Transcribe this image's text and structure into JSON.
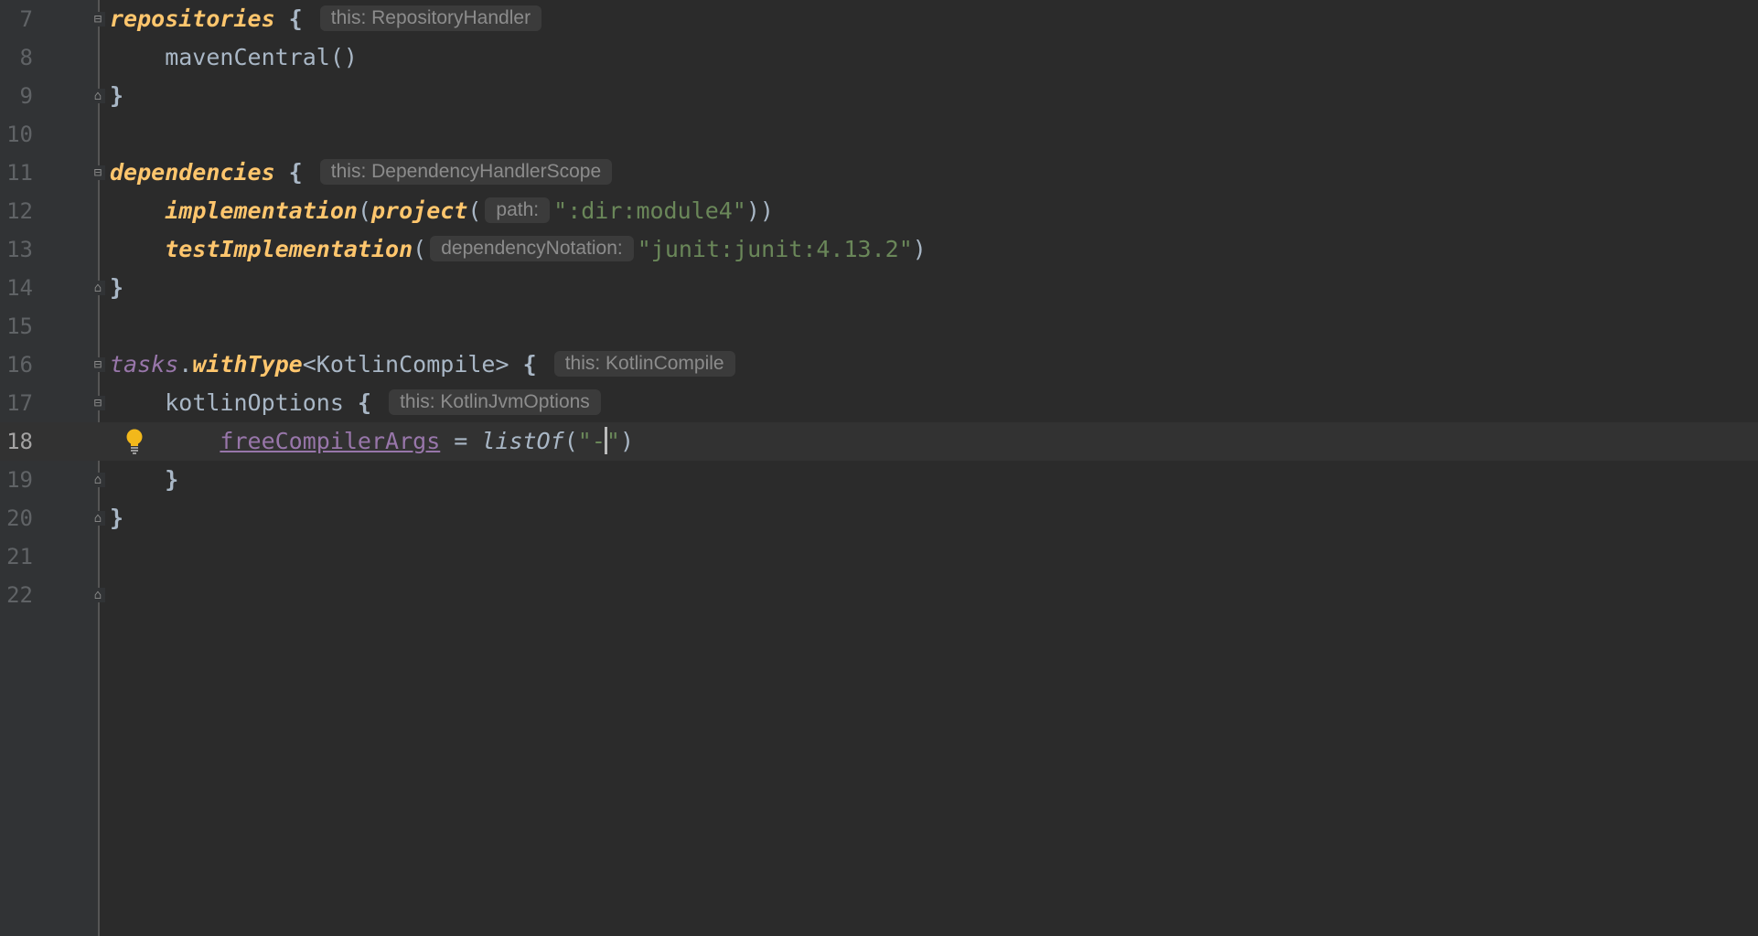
{
  "editor": {
    "lines": [
      {
        "num": "7"
      },
      {
        "num": "8"
      },
      {
        "num": "9"
      },
      {
        "num": "10"
      },
      {
        "num": "11"
      },
      {
        "num": "12"
      },
      {
        "num": "13"
      },
      {
        "num": "14"
      },
      {
        "num": "15"
      },
      {
        "num": "16"
      },
      {
        "num": "17"
      },
      {
        "num": "18"
      },
      {
        "num": "19"
      },
      {
        "num": "20"
      },
      {
        "num": "21"
      },
      {
        "num": "22"
      }
    ],
    "code": {
      "l7_fn": "repositories",
      "l7_brace": " {",
      "l7_hint": "this: RepositoryHandler",
      "l8": "    mavenCentral()",
      "l9": "}",
      "l11_fn": "dependencies",
      "l11_brace": " {",
      "l11_hint": "this: DependencyHandlerScope",
      "l12_indent": "    ",
      "l12_fn": "implementation",
      "l12_p1": "(",
      "l12_fn2": "project",
      "l12_p2": "(",
      "l12_hint": "path:",
      "l12_str": "\":dir:module4\"",
      "l12_close": "))",
      "l13_indent": "    ",
      "l13_fn": "testImplementation",
      "l13_p1": "(",
      "l13_hint": "dependencyNotation:",
      "l13_str": "\"junit:junit:4.13.2\"",
      "l13_close": ")",
      "l14": "}",
      "l16_prop": "tasks",
      "l16_dot": ".",
      "l16_fn": "withType",
      "l16_generic": "<KotlinCompile>",
      "l16_brace": " {",
      "l16_hint": "this: KotlinCompile",
      "l17_indent": "    ",
      "l17_name": "kotlinOptions",
      "l17_brace": " {",
      "l17_hint": "this: KotlinJvmOptions",
      "l18_indent": "        ",
      "l18_prop": "freeCompilerArgs",
      "l18_eq": " = ",
      "l18_fn": "listOf",
      "l18_p1": "(",
      "l18_str_a": "\"-",
      "l18_str_b": "\"",
      "l18_close": ")",
      "l19": "    }",
      "l20": "}"
    }
  },
  "colors": {
    "background": "#2b2b2b",
    "function": "#ffc66d",
    "property": "#9876aa",
    "string": "#6a8759",
    "text": "#a9b7c6",
    "bulb": "#f2b81b"
  },
  "icons": {
    "intention": "lightbulb-icon",
    "fold": "fold-marker-icon"
  }
}
